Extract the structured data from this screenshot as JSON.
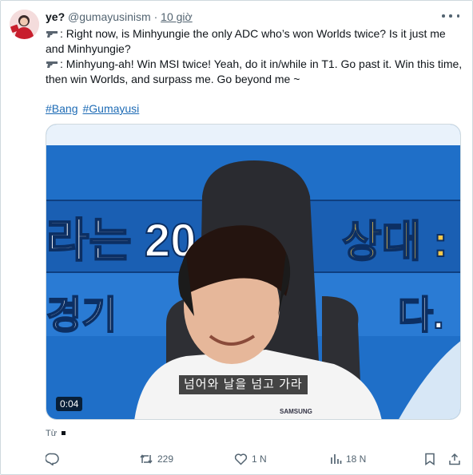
{
  "post": {
    "display_name": "ye?",
    "handle": "@gumayusinism",
    "separator": "·",
    "time": "10 giờ",
    "lines": [
      ": Right now, is Minhyungie the only ADC who’s won Worlds twice? Is it just me",
      "and Minhyungie?",
      ": Minhyung-ah! Win MSI twice! Yeah, do it in/while in T1. Go past it. Win this time,",
      "then win Worlds, and surpass me. Go beyond me ~"
    ],
    "hashtags": [
      "#Bang",
      "#Gumayusi"
    ]
  },
  "media": {
    "overlay_text": "넘어와 날을 넘고 가라",
    "duration": "0:04",
    "background_banner": [
      "라는 20",
      "상대 :",
      "경기",
      "다."
    ],
    "shirt_text": "SAMSUNG"
  },
  "footer": {
    "from_label": "Từ"
  },
  "actions": {
    "retweets": "229",
    "likes": "1 N",
    "views": "18 N"
  },
  "colors": {
    "link": "#1d6bb5",
    "muted": "#536471",
    "video_blue": "#1f6fc8",
    "banner_yellow": "#f5c84a"
  }
}
